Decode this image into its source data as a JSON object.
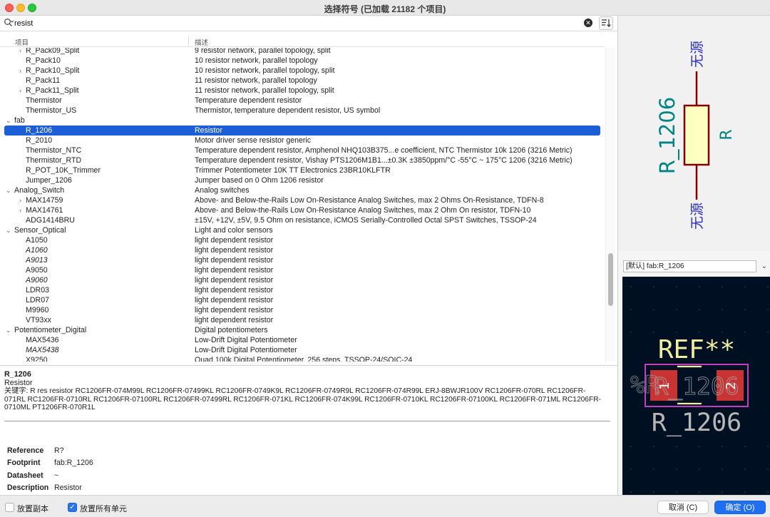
{
  "window": {
    "title": "选择符号 (已加载 21182 个项目)"
  },
  "search": {
    "value": "resist"
  },
  "columns": {
    "item": "项目",
    "description": "描述"
  },
  "tree": [
    {
      "indent": 2,
      "arrow": "›",
      "name": "R_Pack09_Split",
      "desc": "9 resistor network, parallel topology, split"
    },
    {
      "indent": 2,
      "arrow": "",
      "name": "R_Pack10",
      "desc": "10 resistor network, parallel topology"
    },
    {
      "indent": 2,
      "arrow": "›",
      "name": "R_Pack10_Split",
      "desc": "10 resistor network, parallel topology, split"
    },
    {
      "indent": 2,
      "arrow": "",
      "name": "R_Pack11",
      "desc": "11 resistor network, parallel topology"
    },
    {
      "indent": 2,
      "arrow": "›",
      "name": "R_Pack11_Split",
      "desc": "11 resistor network, parallel topology, split"
    },
    {
      "indent": 2,
      "arrow": "",
      "name": "Thermistor",
      "desc": "Temperature dependent resistor"
    },
    {
      "indent": 2,
      "arrow": "",
      "name": "Thermistor_US",
      "desc": "Thermistor, temperature dependent resistor, US symbol"
    },
    {
      "indent": 1,
      "arrow": "⌄",
      "name": "fab",
      "desc": ""
    },
    {
      "indent": 2,
      "arrow": "",
      "name": "R_1206",
      "desc": "Resistor",
      "selected": true
    },
    {
      "indent": 2,
      "arrow": "",
      "name": "R_2010",
      "desc": "Motor driver sense resistor generic"
    },
    {
      "indent": 2,
      "arrow": "",
      "name": "Thermistor_NTC",
      "desc": "Temperature dependent resistor, Amphenol NHQ103B375...e coefficient, NTC Thermistor 10k 1206 (3216 Metric)"
    },
    {
      "indent": 2,
      "arrow": "",
      "name": "Thermistor_RTD",
      "desc": "Temperature dependent resistor, Vishay PTS1206M1B1...±0.3K ±3850ppm/°C -55°C ~ 175°C 1206 (3216 Metric)"
    },
    {
      "indent": 2,
      "arrow": "",
      "name": "R_POT_10K_Trimmer",
      "desc": "Trimmer Potentiometer 10K TT Electronics 23BR10KLFTR"
    },
    {
      "indent": 2,
      "arrow": "",
      "name": "Jumper_1206",
      "desc": "Jumper based on 0 Ohm 1206 resistor"
    },
    {
      "indent": 1,
      "arrow": "⌄",
      "name": "Analog_Switch",
      "desc": "Analog switches"
    },
    {
      "indent": 2,
      "arrow": "›",
      "name": "MAX14759",
      "desc": "Above- and Below-the-Rails Low On-Resistance Analog Switches, max 2 Ohms On-Resistance, TDFN-8"
    },
    {
      "indent": 2,
      "arrow": "›",
      "name": "MAX14761",
      "desc": "Above- and Below-the-Rails Low On-Resistance Analog Switches, max 2 Ohm On resistor, TDFN-10"
    },
    {
      "indent": 2,
      "arrow": "",
      "name": "ADG1414BRU",
      "desc": "±15V, +12V, ±5V, 9.5 Ohm on resistance, iCMOS Serially-Controlled Octal SPST Switches, TSSOP-24"
    },
    {
      "indent": 1,
      "arrow": "⌄",
      "name": "Sensor_Optical",
      "desc": "Light and color sensors"
    },
    {
      "indent": 2,
      "arrow": "",
      "name": "A1050",
      "desc": "light dependent resistor"
    },
    {
      "indent": 2,
      "arrow": "",
      "name": "A1060",
      "desc": "light dependent resistor",
      "italic": true
    },
    {
      "indent": 2,
      "arrow": "",
      "name": "A9013",
      "desc": "light dependent resistor",
      "italic": true
    },
    {
      "indent": 2,
      "arrow": "",
      "name": "A9050",
      "desc": "light dependent resistor"
    },
    {
      "indent": 2,
      "arrow": "",
      "name": "A9060",
      "desc": "light dependent resistor",
      "italic": true
    },
    {
      "indent": 2,
      "arrow": "",
      "name": "LDR03",
      "desc": "light dependent resistor"
    },
    {
      "indent": 2,
      "arrow": "",
      "name": "LDR07",
      "desc": "light dependent resistor"
    },
    {
      "indent": 2,
      "arrow": "",
      "name": "M9960",
      "desc": "light dependent resistor"
    },
    {
      "indent": 2,
      "arrow": "",
      "name": "VT93xx",
      "desc": "light dependent resistor"
    },
    {
      "indent": 1,
      "arrow": "⌄",
      "name": "Potentiometer_Digital",
      "desc": "Digital potentiometers"
    },
    {
      "indent": 2,
      "arrow": "",
      "name": "MAX5436",
      "desc": "Low-Drift Digital Potentiometer"
    },
    {
      "indent": 2,
      "arrow": "",
      "name": "MAX5438",
      "desc": "Low-Drift Digital Potentiometer",
      "italic": true
    },
    {
      "indent": 2,
      "arrow": "",
      "name": "X9250",
      "desc": "Quad 100k Digital Potentiometer, 256 steps, TSSOP-24/SOIC-24"
    }
  ],
  "details": {
    "name": "R_1206",
    "subtitle": "Resistor",
    "keywords_label": "关键字:",
    "keywords": "R res resistor RC1206FR-074M99L RC1206FR-07499KL RC1206FR-0749K9L RC1206FR-0749R9L RC1206FR-074R99L ERJ-8BWJR100V RC1206FR-070RL RC1206FR-071RL RC1206FR-0710RL RC1206FR-07100RL RC1206FR-07499RL RC1206FR-071KL RC1206FR-074K99L RC1206FR-0710KL RC1206FR-07100KL RC1206FR-071ML RC1206FR-0710ML PT1206FR-070R1L",
    "fields": [
      {
        "key": "Reference",
        "value": "R?"
      },
      {
        "key": "Footprint",
        "value": "fab:R_1206"
      },
      {
        "key": "Datasheet",
        "value": "~"
      },
      {
        "key": "Description",
        "value": "Resistor"
      }
    ]
  },
  "symbol_preview": {
    "value": "R_1206",
    "reference": "R",
    "pin_top": "无源",
    "pin_bottom": "无源"
  },
  "footprint": {
    "selector": "[默认] fab:R_1206",
    "ref_text": "REF**",
    "value_text": "R_1206",
    "silk_ref_text": "%R",
    "pad1": "1",
    "pad2": "2"
  },
  "bottom": {
    "copy_label": "放置副本",
    "copy_checked": false,
    "all_units_label": "放置所有单元",
    "all_units_checked": true,
    "cancel": "取消 (C)",
    "ok": "确定 (O)"
  },
  "colors": {
    "selection": "#1c5ed6",
    "accent": "#1f6ff0",
    "symbol_body": "#840000",
    "symbol_fill": "#ffffc2",
    "fp_pad": "#c83434",
    "fp_silk": "#f2eda1",
    "fp_courtyard": "#c040c0"
  }
}
